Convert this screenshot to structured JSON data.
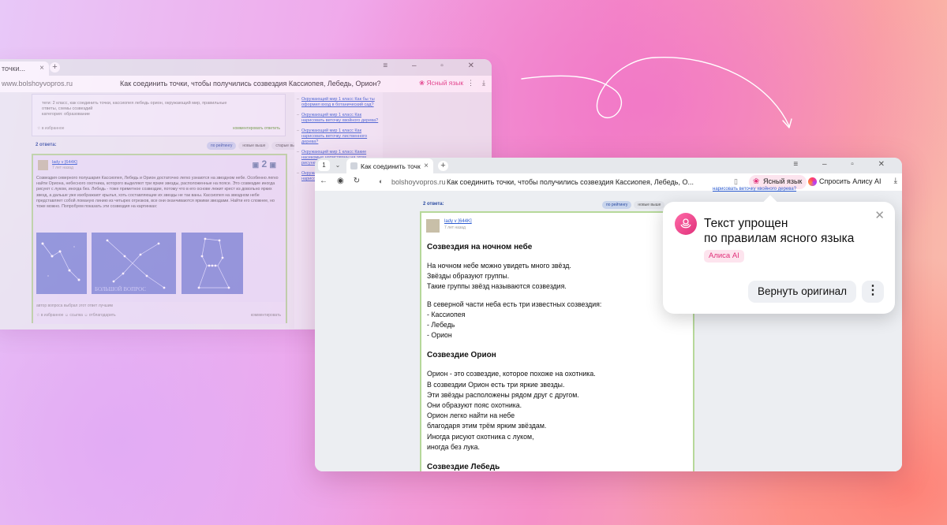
{
  "back_browser": {
    "tab_label": "точки...",
    "url": "www.bolshoyvopros.ru",
    "page_title": "Как соединить точки, чтобы получились созвездия Кассиопея, Лебедь, Орион?",
    "yasny_label": "Ясный язык",
    "tags_line": "теги: 2 класс, как соединить точки, кассиопея лебедь орион, окружающий мир, правильные ответы, схемы созвездий",
    "category": "категория: образование",
    "fav": "☆ в избранное",
    "actions": "комментировать   ответить",
    "answers_count": "2 ответа:",
    "sort": [
      "по рейтингу",
      "новые выше",
      "старые выше"
    ],
    "author": "lady v [644K]",
    "time": "7 лет назад",
    "vote": "2",
    "answer_text": "Созвездия северного полушария Кассиопея, Лебедь и Орион достаточно легко узнаются на звездном небе. Особенно легко найти Ориона, небесного охотника, которого выделяют три яркие звезды, расположенные на поясе. Это созвездие иногда рисуют с луком, иногда без. Лебедь - тоже приметное созвездие, потому что в его основе лежит крест из довольно ярких звезд, а дальше уже изображают крылья, хоть составляющие их звезды не так ваны. Кассиопея на звездном небе представляет собой ломаную линию из четырех отрезков, все они оканчиваются яркими звездами. Найти его сложнее, но тоже можно. Попробуем показать эти созвездия на картинках:",
    "watermark": "БОЛЬШОЙ ВОПРОС",
    "foot_a": "автор вопроса выбрал этот ответ лучшим",
    "foot_b": "☆ в избранное   ☺ ссылка   ☺ отблагодарить",
    "foot_c": "комментировать",
    "side_links": [
      "Окружающий мир 1 класс Как бы ты оформил вход в ботанический сад?",
      "Окружающий мир 1 класс Как нарисовать веточку хвойного дерева?",
      "Окружающий мир 1 класс Как нарисовать веточку лиственного дерева?",
      "Окружающий мир 1 класс Какие насекомые нарисованы на этом рисунке?",
      "Окружающий мир 1 класс Как нарисовать веточку хвойного дерева?"
    ]
  },
  "front_browser": {
    "tab_number": "1",
    "tab_label": "Как соединить точк",
    "url": "bolshoyvopros.ru",
    "page_title": "Как соединить точки, чтобы получились созвездия Кассиопея, Лебедь, О...",
    "yasny_label": "Ясный язык",
    "alice_label": "Спросить Алису AI",
    "answers_count": "2 ответа:",
    "sort": [
      "по рейтингу",
      "новые выше"
    ],
    "author": "lady v [644K]",
    "time": "7 лет назад",
    "side_link": "нарисовать веточку хвойного дерева?",
    "sections": [
      {
        "heading": "Созвездия на ночном небе",
        "paras": [
          "На ночном небе можно увидеть много звёзд.\nЗвёзды образуют группы.\nТакие группы звёзд называются созвездия.",
          "В северной части неба есть три известных созвездия:\n- Кассиопея\n- Лебедь\n- Орион"
        ]
      },
      {
        "heading": "Созвездие Орион",
        "paras": [
          "Орион - это созвездие, которое похоже на охотника.\nВ созвездии Орион есть три яркие звезды.\nЭти звёзды расположены рядом друг с другом.\nОни образуют пояс охотника.\nОрион легко найти на небе\nблагодаря этим трём ярким звёздам.\nИногда рисуют охотника с луком,\nиногда без лука."
        ]
      },
      {
        "heading": "Созвездие Лебедь",
        "paras": []
      }
    ]
  },
  "popup": {
    "title_line1": "Текст упрощен",
    "title_line2": "по правилам ясного языка",
    "tag": "Алиса AI",
    "revert_label": "Вернуть оригинал",
    "more_label": "⋮",
    "close_label": "✕"
  },
  "colors": {
    "accent_pink": "#e0317a",
    "link_blue": "#2a5ad0",
    "answer_border": "#b6d89a"
  }
}
